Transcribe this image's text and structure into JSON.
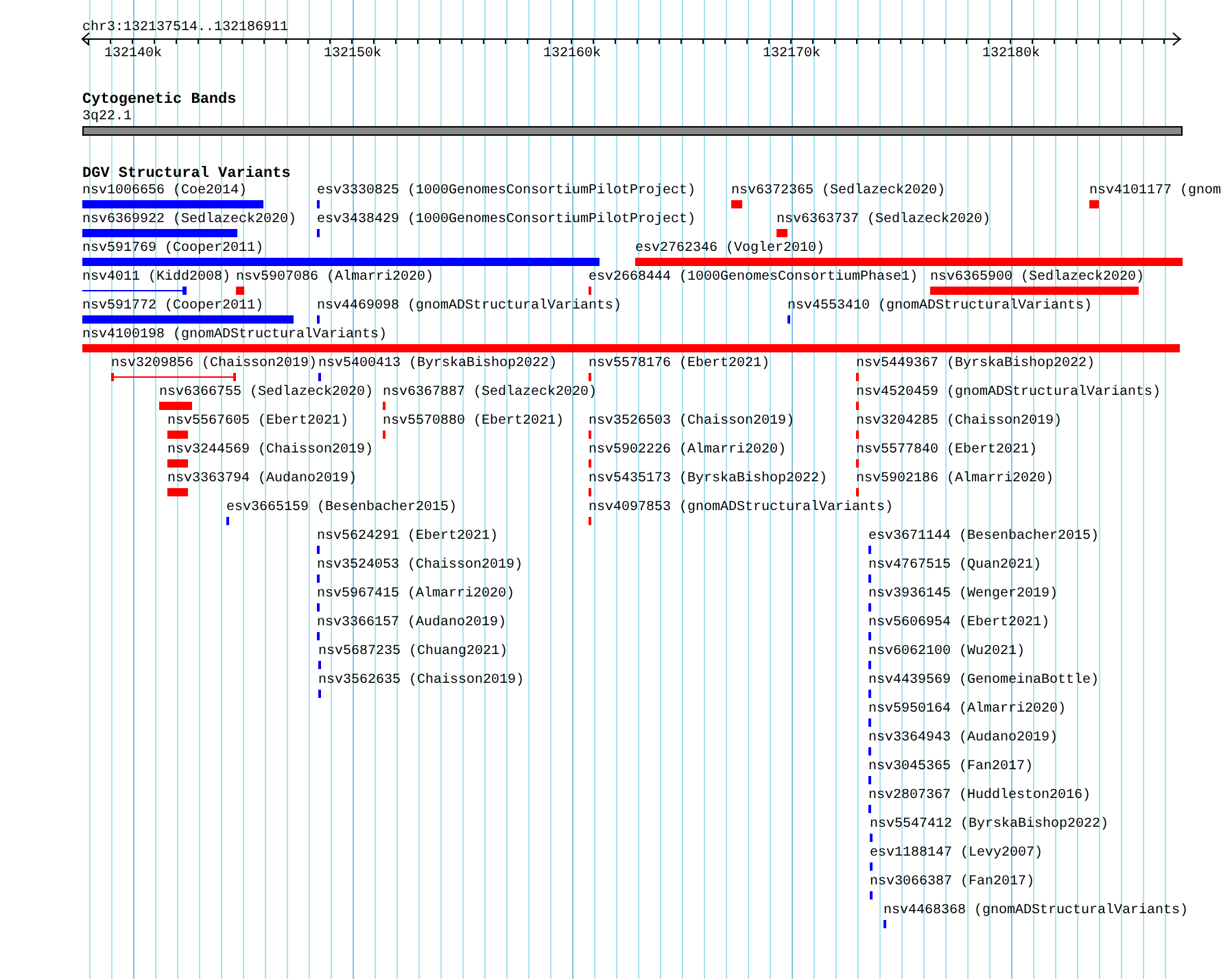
{
  "ruler": {
    "region": "chr3:132137514..132186911",
    "ticks": [
      "132140k",
      "132150k",
      "132160k",
      "132170k",
      "132180k"
    ]
  },
  "cytoband_track": {
    "title": "Cytogenetic Bands",
    "band": "3q22.1"
  },
  "dgv_track": {
    "title": "DGV Structural Variants",
    "features": [
      {
        "label": "nsv1006656 (Coe2014)",
        "color": "#0000ff",
        "kind": "bar"
      },
      {
        "label": "esv3330825 (1000GenomesConsortiumPilotProject)",
        "color": "#0000ff",
        "kind": "bar"
      },
      {
        "label": "nsv6372365 (Sedlazeck2020)",
        "color": "#ff0000",
        "kind": "bar"
      },
      {
        "label": "nsv4101177 (gnom",
        "color": "#ff0000",
        "kind": "bar"
      },
      {
        "label": "nsv6369922 (Sedlazeck2020)",
        "color": "#0000ff",
        "kind": "bar"
      },
      {
        "label": "esv3438429 (1000GenomesConsortiumPilotProject)",
        "color": "#0000ff",
        "kind": "bar"
      },
      {
        "label": "nsv6363737 (Sedlazeck2020)",
        "color": "#ff0000",
        "kind": "bar"
      },
      {
        "label": "nsv591769 (Cooper2011)",
        "color": "#0000ff",
        "kind": "bar"
      },
      {
        "label": "esv2762346 (Vogler2010)",
        "color": "#ff0000",
        "kind": "bar"
      },
      {
        "label": "nsv4011 (Kidd2008)",
        "color": "#0000ff",
        "kind": "line"
      },
      {
        "label": "nsv5907086 (Almarri2020)",
        "color": "#ff0000",
        "kind": "bar"
      },
      {
        "label": "esv2668444 (1000GenomesConsortiumPhase1)",
        "color": "#ff0000",
        "kind": "bar"
      },
      {
        "label": "nsv6365900 (Sedlazeck2020)",
        "color": "#ff0000",
        "kind": "bar"
      },
      {
        "label": "nsv591772 (Cooper2011)",
        "color": "#0000ff",
        "kind": "bar"
      },
      {
        "label": "nsv4469098 (gnomADStructuralVariants)",
        "color": "#0000ff",
        "kind": "bar"
      },
      {
        "label": "nsv4553410 (gnomADStructuralVariants)",
        "color": "#0000ff",
        "kind": "bar"
      },
      {
        "label": "nsv4100198 (gnomADStructuralVariants)",
        "color": "#ff0000",
        "kind": "bar"
      },
      {
        "label": "nsv3209856 (Chaisson2019)",
        "color": "#ff0000",
        "kind": "span"
      },
      {
        "label": "nsv5400413 (ByrskaBishop2022)",
        "color": "#0000ff",
        "kind": "bar"
      },
      {
        "label": "nsv5578176 (Ebert2021)",
        "color": "#ff0000",
        "kind": "bar"
      },
      {
        "label": "nsv5449367 (ByrskaBishop2022)",
        "color": "#ff0000",
        "kind": "bar"
      },
      {
        "label": "nsv6366755 (Sedlazeck2020)",
        "color": "#ff0000",
        "kind": "bar"
      },
      {
        "label": "nsv6367887 (Sedlazeck2020)",
        "color": "#ff0000",
        "kind": "bar"
      },
      {
        "label": "nsv4520459 (gnomADStructuralVariants)",
        "color": "#ff0000",
        "kind": "bar"
      },
      {
        "label": "nsv5567605 (Ebert2021)",
        "color": "#ff0000",
        "kind": "bar"
      },
      {
        "label": "nsv5570880 (Ebert2021)",
        "color": "#ff0000",
        "kind": "bar"
      },
      {
        "label": "nsv3526503 (Chaisson2019)",
        "color": "#ff0000",
        "kind": "bar"
      },
      {
        "label": "nsv3204285 (Chaisson2019)",
        "color": "#ff0000",
        "kind": "bar"
      },
      {
        "label": "nsv3244569 (Chaisson2019)",
        "color": "#ff0000",
        "kind": "bar"
      },
      {
        "label": "nsv5902226 (Almarri2020)",
        "color": "#ff0000",
        "kind": "bar"
      },
      {
        "label": "nsv5577840 (Ebert2021)",
        "color": "#ff0000",
        "kind": "bar"
      },
      {
        "label": "nsv3363794 (Audano2019)",
        "color": "#ff0000",
        "kind": "bar"
      },
      {
        "label": "nsv5435173 (ByrskaBishop2022)",
        "color": "#ff0000",
        "kind": "bar"
      },
      {
        "label": "nsv5902186 (Almarri2020)",
        "color": "#ff0000",
        "kind": "bar"
      },
      {
        "label": "esv3665159 (Besenbacher2015)",
        "color": "#0000ff",
        "kind": "bar"
      },
      {
        "label": "nsv4097853 (gnomADStructuralVariants)",
        "color": "#ff0000",
        "kind": "bar"
      },
      {
        "label": "nsv5624291 (Ebert2021)",
        "color": "#0000ff",
        "kind": "bar"
      },
      {
        "label": "esv3671144 (Besenbacher2015)",
        "color": "#0000ff",
        "kind": "bar"
      },
      {
        "label": "nsv3524053 (Chaisson2019)",
        "color": "#0000ff",
        "kind": "bar"
      },
      {
        "label": "nsv4767515 (Quan2021)",
        "color": "#0000ff",
        "kind": "bar"
      },
      {
        "label": "nsv5967415 (Almarri2020)",
        "color": "#0000ff",
        "kind": "bar"
      },
      {
        "label": "nsv3936145 (Wenger2019)",
        "color": "#0000ff",
        "kind": "bar"
      },
      {
        "label": "nsv3366157 (Audano2019)",
        "color": "#0000ff",
        "kind": "bar"
      },
      {
        "label": "nsv5606954 (Ebert2021)",
        "color": "#0000ff",
        "kind": "bar"
      },
      {
        "label": "nsv5687235 (Chuang2021)",
        "color": "#0000ff",
        "kind": "bar"
      },
      {
        "label": "nsv6062100 (Wu2021)",
        "color": "#0000ff",
        "kind": "bar"
      },
      {
        "label": "nsv3562635 (Chaisson2019)",
        "color": "#0000ff",
        "kind": "bar"
      },
      {
        "label": "nsv4439569 (GenomeinaBottle)",
        "color": "#0000ff",
        "kind": "bar"
      },
      {
        "label": "nsv5950164 (Almarri2020)",
        "color": "#0000ff",
        "kind": "bar"
      },
      {
        "label": "nsv3364943 (Audano2019)",
        "color": "#0000ff",
        "kind": "bar"
      },
      {
        "label": "nsv3045365 (Fan2017)",
        "color": "#0000ff",
        "kind": "bar"
      },
      {
        "label": "nsv2807367 (Huddleston2016)",
        "color": "#0000ff",
        "kind": "bar"
      },
      {
        "label": "nsv5547412 (ByrskaBishop2022)",
        "color": "#0000ff",
        "kind": "bar"
      },
      {
        "label": "esv1188147 (Levy2007)",
        "color": "#0000ff",
        "kind": "bar"
      },
      {
        "label": "nsv3066387 (Fan2017)",
        "color": "#0000ff",
        "kind": "bar"
      },
      {
        "label": "nsv4468368 (gnomADStructuralVariants)",
        "color": "#0000ff",
        "kind": "bar"
      }
    ]
  }
}
